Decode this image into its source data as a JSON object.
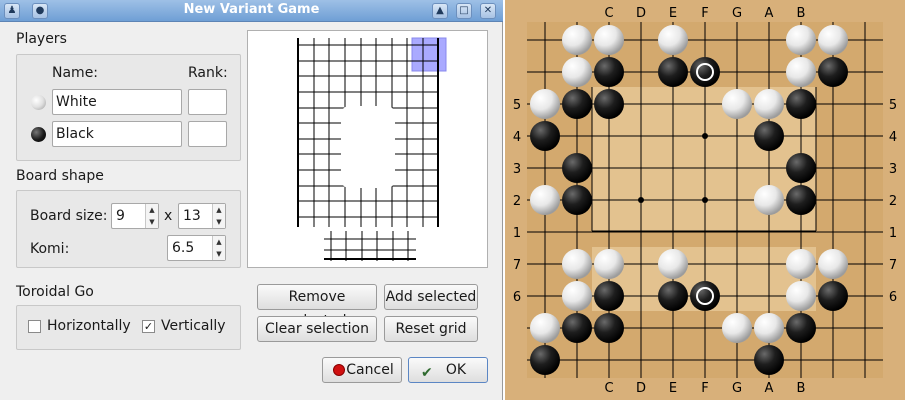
{
  "window": {
    "title": "New Variant Game"
  },
  "players": {
    "section_label": "Players",
    "name_header": "Name:",
    "rank_header": "Rank:",
    "white": {
      "name": "White",
      "rank": ""
    },
    "black": {
      "name": "Black",
      "rank": ""
    }
  },
  "board_shape": {
    "section_label": "Board shape",
    "size_label": "Board size:",
    "width": "9",
    "times": "x",
    "height": "13",
    "komi_label": "Komi:",
    "komi": "6.5"
  },
  "toroidal": {
    "section_label": "Toroidal Go",
    "horizontally_label": "Horizontally",
    "horizontally_checked": false,
    "vertically_label": "Vertically",
    "vertically_checked": true
  },
  "grid_buttons": {
    "remove_selected": "Remove selected",
    "add_selected": "Add selected",
    "clear_selection": "Clear selection",
    "reset_grid": "Reset grid"
  },
  "dialog_buttons": {
    "cancel": "Cancel",
    "ok": "OK"
  },
  "board": {
    "col_labels": [
      "C",
      "D",
      "E",
      "F",
      "G",
      "A",
      "B"
    ],
    "row_labels": [
      "5",
      "4",
      "3",
      "2",
      "1",
      "7",
      "6"
    ],
    "colors": {
      "wood": "#d9b27a",
      "highlight": "#e7c99c"
    }
  }
}
